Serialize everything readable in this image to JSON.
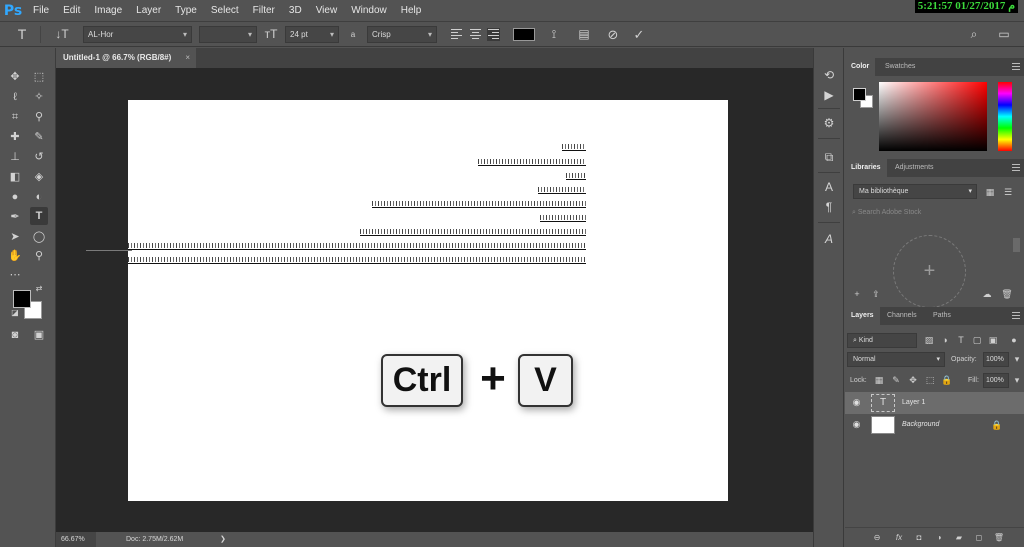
{
  "app": {
    "logo": "Ps",
    "clock": "5:21:57 01/27/2017 م"
  },
  "menu": [
    "File",
    "Edit",
    "Image",
    "Layer",
    "Type",
    "Select",
    "Filter",
    "3D",
    "View",
    "Window",
    "Help"
  ],
  "options": {
    "font_family": "AL-Hor",
    "font_style": "",
    "font_size": "24 pt",
    "aa_label": "a",
    "antialias": "Crisp",
    "text_color": "#000000"
  },
  "document": {
    "tab_title": "Untitled-1 @ 66.7% (RGB/8#)",
    "close_glyph": "×",
    "zoom": "66.67%",
    "doc_size": "Doc: 2.75M/2.62M",
    "status_arrow": "❯",
    "keycaps": {
      "ctrl": "Ctrl",
      "plus": "+",
      "v": "V"
    }
  },
  "color_panel": {
    "tabs": [
      "Color",
      "Swatches"
    ]
  },
  "libraries_panel": {
    "tabs": [
      "Libraries",
      "Adjustments"
    ],
    "library": "Ma bibliothèque",
    "search_placeholder": "Search Adobe Stock",
    "add_glyph": "+"
  },
  "layers_panel": {
    "tabs": [
      "Layers",
      "Channels",
      "Paths"
    ],
    "kind": "Kind",
    "blend_mode": "Normal",
    "opacity_label": "Opacity:",
    "opacity": "100%",
    "lock_label": "Lock:",
    "fill_label": "Fill:",
    "fill": "100%",
    "layers": [
      {
        "name": "Layer 1",
        "type": "text",
        "selected": true
      },
      {
        "name": "Background",
        "type": "background",
        "locked": true
      }
    ]
  },
  "colors": {
    "accent": "#31a8ff",
    "clock_text": "#3cdc3c",
    "ui_bg": "#535353",
    "canvas_bg": "#282828"
  }
}
